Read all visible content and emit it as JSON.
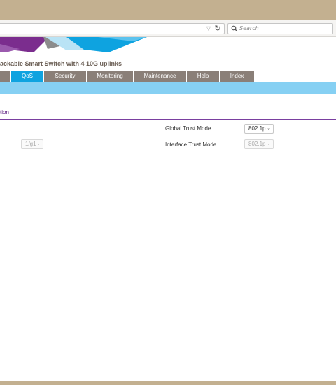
{
  "browser": {
    "search_placeholder": "Search",
    "url_dropdown_icon": "▽",
    "reload_icon": "↻"
  },
  "header": {
    "title": "ackable Smart Switch with 4 10G uplinks",
    "colors": {
      "accent_purple": "#7b2d8e",
      "accent_blue": "#0ea3e0"
    }
  },
  "nav": {
    "tabs": [
      {
        "label": ""
      },
      {
        "label": "QoS"
      },
      {
        "label": "Security"
      },
      {
        "label": "Monitoring"
      },
      {
        "label": "Maintenance"
      },
      {
        "label": "Help"
      },
      {
        "label": "Index"
      }
    ],
    "active_index": 1
  },
  "content": {
    "section_tab": "tion",
    "port_select_value": "1/g1",
    "global_trust_mode_label": "Global Trust Mode",
    "global_trust_mode_value": "802.1p",
    "interface_trust_mode_label": "Interface Trust Mode",
    "interface_trust_mode_value": "802.1p"
  }
}
